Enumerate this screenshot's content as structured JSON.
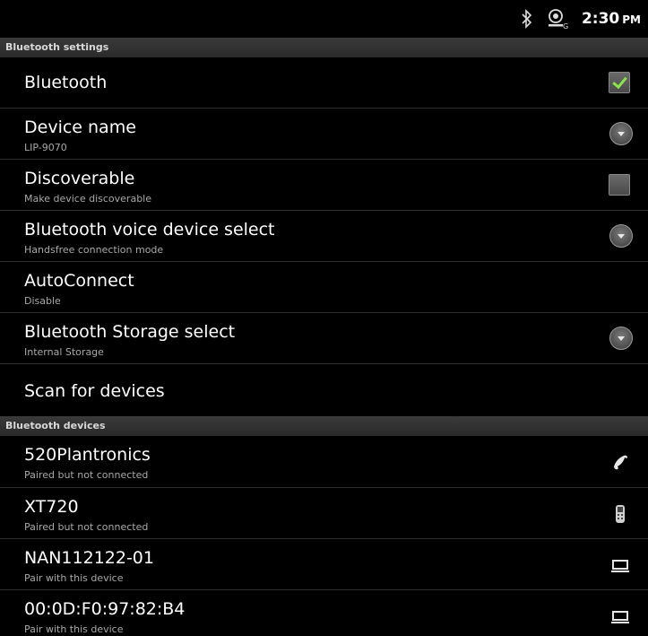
{
  "status_bar": {
    "time": "2:30",
    "ampm": "PM",
    "icons": [
      "bluetooth-icon",
      "gps-icon"
    ]
  },
  "sections": {
    "settings_header": "Bluetooth settings",
    "devices_header": "Bluetooth devices"
  },
  "settings": {
    "bluetooth": {
      "title": "Bluetooth",
      "checked": true
    },
    "device_name": {
      "title": "Device name",
      "subtitle": "LIP-9070"
    },
    "discoverable": {
      "title": "Discoverable",
      "subtitle": "Make device discoverable",
      "checked": false
    },
    "voice_select": {
      "title": "Bluetooth voice device select",
      "subtitle": "Handsfree connection mode"
    },
    "autoconnect": {
      "title": "AutoConnect",
      "subtitle": "Disable"
    },
    "storage_select": {
      "title": "Bluetooth Storage select",
      "subtitle": "Internal Storage"
    },
    "scan": {
      "title": "Scan for devices"
    }
  },
  "devices": [
    {
      "name": "520Plantronics",
      "status": "Paired but not connected",
      "icon": "phone-handset-icon"
    },
    {
      "name": "XT720",
      "status": "Paired but not connected",
      "icon": "mobile-phone-icon"
    },
    {
      "name": "NAN112122-01",
      "status": "Pair with this device",
      "icon": "laptop-icon"
    },
    {
      "name": "00:0D:F0:97:82:B4",
      "status": "Pair with this device",
      "icon": "laptop-icon"
    }
  ],
  "colors": {
    "background": "#000000",
    "section_header": "#2a2a2a",
    "check_accent": "#8ce34a",
    "subtitle": "#a8a8a8"
  }
}
